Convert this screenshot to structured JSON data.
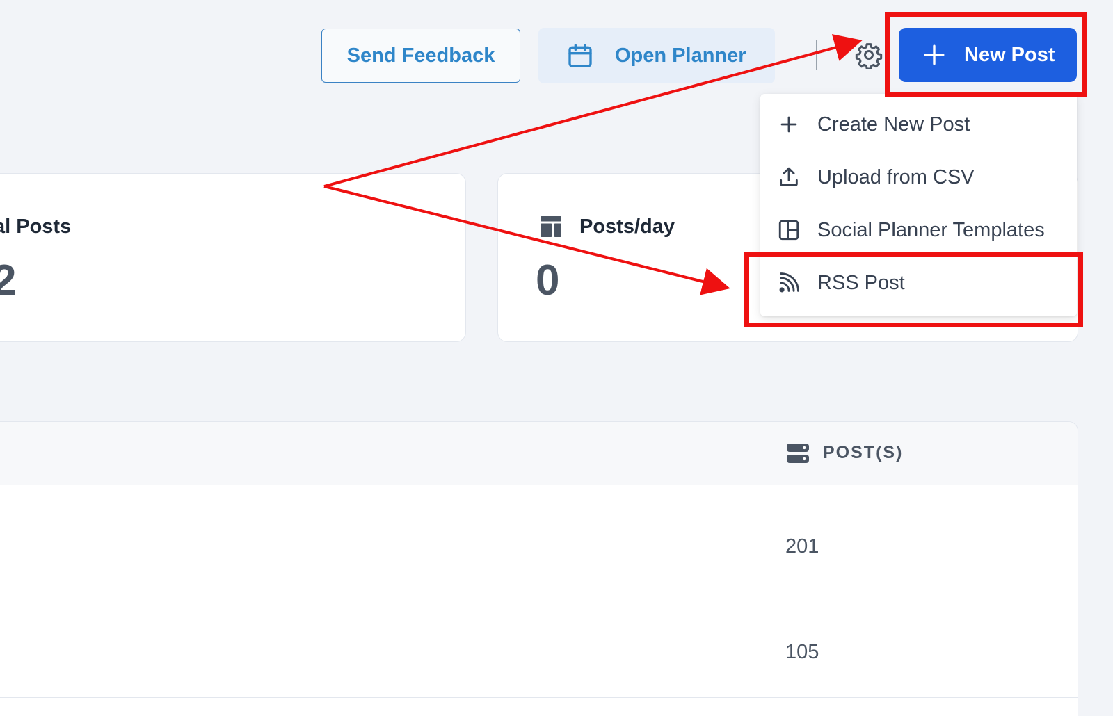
{
  "header": {
    "feedback_label": "Send Feedback",
    "planner_label": "Open Planner",
    "new_post_label": "New Post"
  },
  "stats": {
    "total_posts_label": "al Posts",
    "total_posts_value": "2",
    "posts_per_day_label": "Posts/day",
    "posts_per_day_value": "0"
  },
  "table": {
    "column_posts": "POST(S)",
    "rows": [
      {
        "posts": "201"
      },
      {
        "posts": "105"
      }
    ]
  },
  "menu": {
    "items": [
      {
        "label": "Create New Post",
        "icon": "plus-icon"
      },
      {
        "label": "Upload from CSV",
        "icon": "upload-icon"
      },
      {
        "label": "Social Planner Templates",
        "icon": "template-icon"
      },
      {
        "label": "RSS Post",
        "icon": "rss-icon"
      }
    ]
  },
  "colors": {
    "primary": "#1d5fe0",
    "link": "#2f86c9",
    "annotation": "#ee1111",
    "background": "#f2f4f8"
  }
}
